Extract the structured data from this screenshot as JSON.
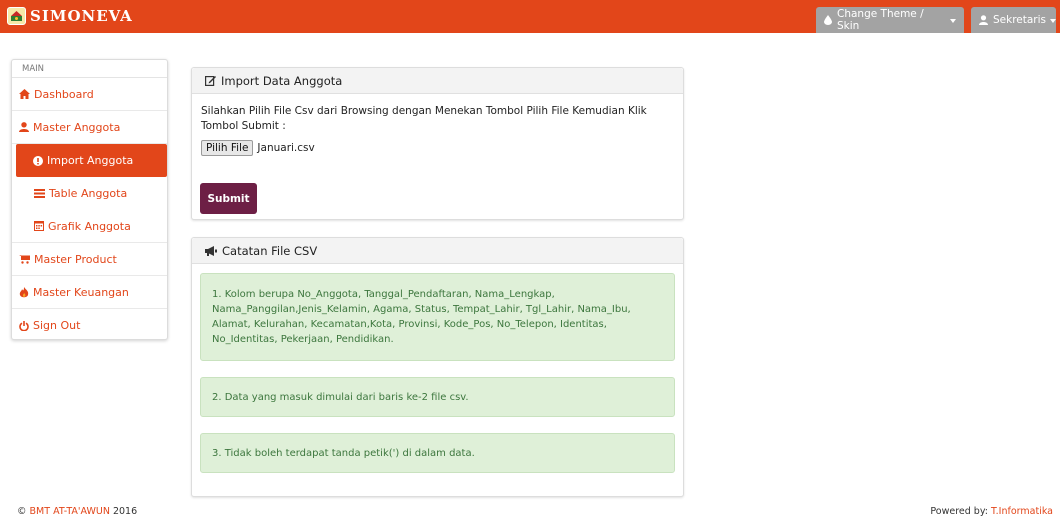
{
  "brand": {
    "name": "SIMONEVA"
  },
  "topnav": {
    "theme_label": "Change Theme / Skin",
    "user_label": "Sekretaris"
  },
  "sidebar": {
    "heading": "MAIN",
    "items": [
      {
        "label": "Dashboard",
        "icon": "home-icon"
      },
      {
        "label": "Master Anggota",
        "icon": "user-icon"
      },
      {
        "label": "Import Anggota",
        "icon": "info-circle-icon",
        "active": true
      },
      {
        "label": "Table Anggota",
        "icon": "list-icon"
      },
      {
        "label": "Grafik Anggota",
        "icon": "calendar-icon"
      },
      {
        "label": "Master Product",
        "icon": "cart-icon"
      },
      {
        "label": "Master Keuangan",
        "icon": "fire-icon"
      },
      {
        "label": "Sign Out",
        "icon": "power-icon"
      }
    ]
  },
  "import_panel": {
    "title": "Import Data Anggota",
    "instructions": "Silahkan Pilih File Csv dari Browsing dengan Menekan Tombol Pilih File Kemudian Klik Tombol Submit :",
    "file_button": "Pilih File",
    "file_name": "Januari.csv",
    "submit_label": "Submit"
  },
  "notes_panel": {
    "title": "Catatan File CSV",
    "notes": [
      "1. Kolom berupa No_Anggota, Tanggal_Pendaftaran, Nama_Lengkap, Nama_Panggilan,Jenis_Kelamin, Agama, Status, Tempat_Lahir, Tgl_Lahir, Nama_Ibu, Alamat, Kelurahan, Kecamatan,Kota, Provinsi, Kode_Pos, No_Telepon, Identitas, No_Identitas, Pekerjaan, Pendidikan.",
      "2. Data yang masuk dimulai dari baris ke-2 file csv.",
      "3. Tidak boleh terdapat tanda petik(') di dalam data."
    ]
  },
  "footer": {
    "copyright_symbol": "©",
    "org": "BMT AT-TA'AWUN",
    "year": "2016",
    "powered_prefix": "Powered by:",
    "powered_by": "T.Informatika"
  },
  "colors": {
    "accent": "#e2461a",
    "submit": "#6d1f45",
    "note_bg": "#dff0d8",
    "note_text": "#3c763d",
    "nav_button": "#a3a3a3"
  }
}
